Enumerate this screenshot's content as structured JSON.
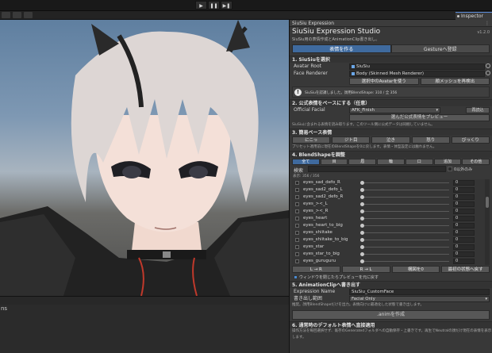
{
  "toolbar": {
    "play": "▶",
    "pause": "❚❚",
    "step": "▶❚"
  },
  "tabs": {
    "inspector": "Inspector"
  },
  "bottom": {
    "tab_label": "ns"
  },
  "panel": {
    "header": "SiuSiu Expression",
    "title": "SiuSiu Expression Studio",
    "version": "v1.2.0",
    "subtitle": "SiuSiu用の表情作成とAnimationClip書き出し。",
    "mode_tabs": [
      {
        "label": "表情を作る",
        "selected": true
      },
      {
        "label": "Gestureへ登録",
        "selected": false
      }
    ],
    "section1": {
      "title": "1. SiuSiuを選択",
      "avatar_root_label": "Avatar Root",
      "avatar_root_value": "SiuSiu",
      "face_renderer_label": "Face Renderer",
      "face_renderer_value": "Body (Skinned Mesh Renderer)",
      "btn_use_avatar": "選択中のAvatarを使う",
      "btn_redetect": "顔メッシュを再検出",
      "info": "SiuSiuを認識しました。顔用BlendShape: 310 / 全 356"
    },
    "section2": {
      "title": "2. 公式表情をベースにする（任意）",
      "label": "Official Facial",
      "value": "AFK_Finish",
      "reload": "再読込",
      "preview_btn": "選んだ公式表情をプレビュー",
      "note": "SiuSiuに含まれる表情を読み取ります。このツール側に公式データは同梱していません。"
    },
    "section3": {
      "title": "3. 簡易ベース表情",
      "buttons": [
        "にこっ",
        "ジト目",
        "泣き",
        "怒り",
        "びっくり"
      ],
      "note": "プリセット適用前に現在のBlendShapeを0に戻します。表情・体型設定には触れません。"
    },
    "section4": {
      "title": "4. BlendShapeを調整",
      "categories": [
        {
          "label": "全て",
          "selected": true
        },
        {
          "label": "目",
          "selected": false
        },
        {
          "label": "眉",
          "selected": false
        },
        {
          "label": "輪",
          "selected": false
        },
        {
          "label": "口",
          "selected": false
        },
        {
          "label": "追加",
          "selected": false
        },
        {
          "label": "その他",
          "selected": false
        }
      ],
      "search_label": "検索",
      "nonzero_label": "0以外のみ",
      "count": "表示: 356 / 356",
      "blendshapes": [
        {
          "name": "eyes_sad_defo_R",
          "value": "0"
        },
        {
          "name": "eyes_sad2_defo_L",
          "value": "0"
        },
        {
          "name": "eyes_sad2_defo_R",
          "value": "0"
        },
        {
          "name": "eyes_><_L",
          "value": "0"
        },
        {
          "name": "eyes_><_R",
          "value": "0"
        },
        {
          "name": "eyes_heart",
          "value": "0"
        },
        {
          "name": "eyes_heart_to_big",
          "value": "0"
        },
        {
          "name": "eyes_shiitake",
          "value": "0"
        },
        {
          "name": "eyes_shiitake_to_big",
          "value": "0"
        },
        {
          "name": "eyes_star",
          "value": "0"
        },
        {
          "name": "eyes_star_to_big",
          "value": "0"
        },
        {
          "name": "eyes_guruguru",
          "value": "0"
        }
      ],
      "mirror_buttons": [
        "L → R",
        "R → L",
        "構図を0",
        "最初の状態へ戻す"
      ],
      "window_toggle": "ウィンドウを閉じたらプレビューを元に戻す"
    },
    "section5": {
      "title": "5. AnimationClipへ書き出す",
      "expr_label": "Expression Name",
      "expr_value": "SiuSiu_CustomFace",
      "range_label": "書き出し範囲",
      "range_value": "Facial Only",
      "note": "推奨。顔用BlendShapeだけを出力。表情向けに最適化した状態で書き出します。",
      "create_btn": ".animを作成"
    },
    "section6": {
      "title": "6. 通常時のデフォルト表情へ直接適用",
      "note": "操作方法を毎回選択せず、既存のGeneratedフォルダへの自動保存・上書きです。再生でNeutralの顔だけ現在の表情を表示します。"
    }
  }
}
